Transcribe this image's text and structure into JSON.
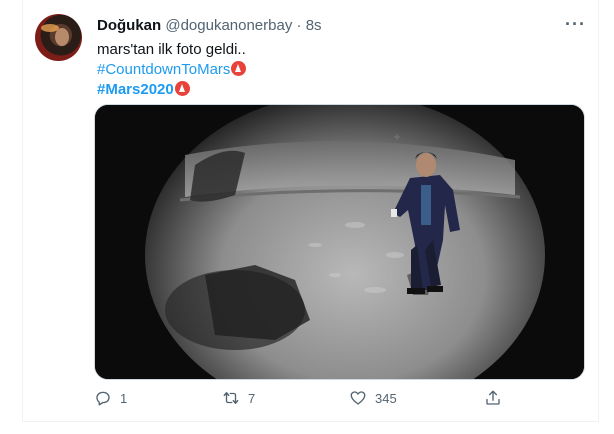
{
  "tweet": {
    "display_name": "Doğukan",
    "handle": "@dogukanonerbay",
    "separator": "·",
    "time": "8s",
    "more_label": "···",
    "text": "mars'tan ilk foto geldi..",
    "hashtags": [
      "#CountdownToMars",
      "#Mars2020"
    ]
  },
  "actions": {
    "replies": "1",
    "retweets": "7",
    "likes": "345"
  },
  "icons": {
    "reply": "reply-icon",
    "retweet": "retweet-icon",
    "like": "heart-icon",
    "share": "share-icon",
    "badge": "nasa-perseverance-badge-icon"
  },
  "colors": {
    "hashtag": "#1d9bf0",
    "secondary_text": "#536471",
    "badge": "#e8423b"
  }
}
